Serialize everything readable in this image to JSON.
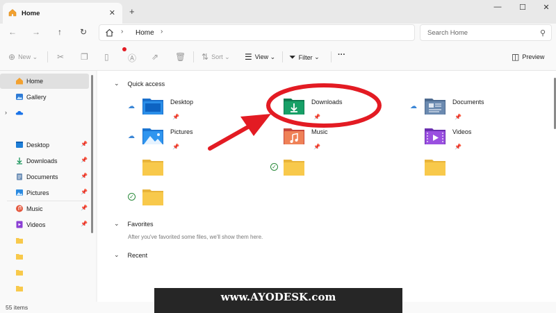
{
  "window": {
    "tab_title": "Home",
    "tab_icon": "home-icon",
    "new_tab_symbol": "+",
    "controls": [
      "minimize-icon",
      "maximize-icon",
      "close-icon"
    ]
  },
  "address": {
    "breadcrumb": "Home",
    "search_placeholder": "Search Home"
  },
  "toolbar": {
    "new_label": "New",
    "sort_label": "Sort",
    "view_label": "View",
    "filter_label": "Filter",
    "more_label": "···",
    "preview_label": "Preview"
  },
  "sidebar": {
    "items": [
      {
        "label": "Home",
        "icon": "home-icon"
      },
      {
        "label": "Gallery",
        "icon": "gallery-icon"
      },
      {
        "label": "",
        "icon": "onedrive-icon"
      },
      {
        "label": "Desktop",
        "icon": "desktop-icon",
        "pinned": true
      },
      {
        "label": "Downloads",
        "icon": "downloads-icon",
        "pinned": true
      },
      {
        "label": "Documents",
        "icon": "documents-icon",
        "pinned": true
      },
      {
        "label": "Pictures",
        "icon": "pictures-icon",
        "pinned": true
      },
      {
        "label": "Music",
        "icon": "music-icon",
        "pinned": true
      },
      {
        "label": "Videos",
        "icon": "videos-icon",
        "pinned": true
      },
      {
        "label": "",
        "icon": "folder-icon"
      },
      {
        "label": "",
        "icon": "folder-icon"
      },
      {
        "label": "",
        "icon": "folder-icon"
      },
      {
        "label": "",
        "icon": "folder-icon"
      }
    ]
  },
  "main": {
    "quick_access_title": "Quick access",
    "quick_access": [
      {
        "name": "Desktop",
        "status": "cloud"
      },
      {
        "name": "Downloads",
        "status": ""
      },
      {
        "name": "Documents",
        "status": "cloud"
      },
      {
        "name": "Pictures",
        "status": "cloud"
      },
      {
        "name": "Music",
        "status": ""
      },
      {
        "name": "Videos",
        "status": ""
      },
      {
        "name": "",
        "status": ""
      },
      {
        "name": "",
        "status": "synced"
      },
      {
        "name": "",
        "status": ""
      },
      {
        "name": "",
        "status": "synced"
      }
    ],
    "favorites_title": "Favorites",
    "favorites_hint": "After you've favorited some files, we'll show them here.",
    "recent_title": "Recent"
  },
  "status": {
    "item_count": "55 items"
  },
  "watermark": "www.AYODESK.com",
  "colors": {
    "annotation_red": "#e31b23",
    "accent_blue": "#3c87d6",
    "folder_yellow": "#f8c94b"
  }
}
